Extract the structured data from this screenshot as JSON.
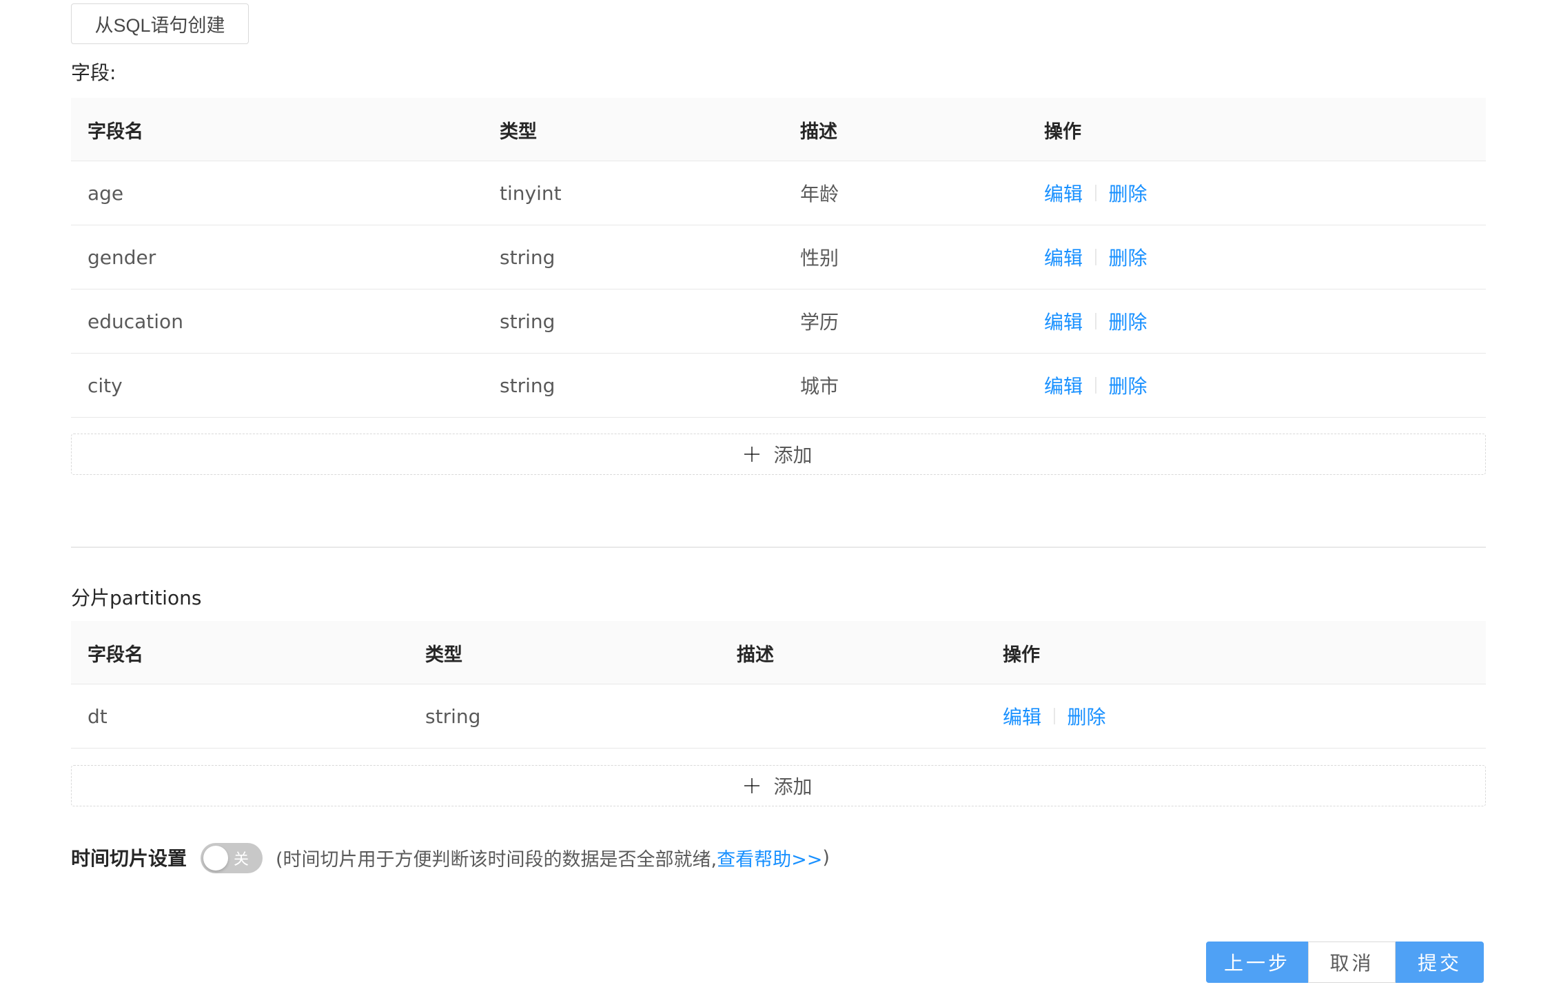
{
  "toolbar": {
    "sql_create_label": "从SQL语句创建"
  },
  "fields_section": {
    "label": "字段:",
    "columns": [
      "字段名",
      "类型",
      "描述",
      "操作"
    ],
    "rows": [
      {
        "name": "age",
        "type": "tinyint",
        "desc": "年龄",
        "edit": "编辑",
        "delete": "删除"
      },
      {
        "name": "gender",
        "type": "string",
        "desc": "性别",
        "edit": "编辑",
        "delete": "删除"
      },
      {
        "name": "education",
        "type": "string",
        "desc": "学历",
        "edit": "编辑",
        "delete": "删除"
      },
      {
        "name": "city",
        "type": "string",
        "desc": "城市",
        "edit": "编辑",
        "delete": "删除"
      }
    ],
    "add_label": "添加"
  },
  "partitions_section": {
    "label": "分片partitions",
    "columns": [
      "字段名",
      "类型",
      "描述",
      "操作"
    ],
    "rows": [
      {
        "name": "dt",
        "type": "string",
        "desc": "",
        "edit": "编辑",
        "delete": "删除"
      }
    ],
    "add_label": "添加"
  },
  "time_slice": {
    "label": "时间切片设置",
    "switch_text": "关",
    "switch_on": false,
    "desc_prefix": "(时间切片用于方便判断该时间段的数据是否全部就绪,",
    "help_link": "查看帮助>>",
    "desc_suffix": ")"
  },
  "footer": {
    "prev_label": "上一步",
    "cancel_label": "取消",
    "submit_label": "提交"
  },
  "colors": {
    "link": "#1890ff",
    "primary_button": "#4fa1f5",
    "switch_off": "#c8c8c8"
  }
}
